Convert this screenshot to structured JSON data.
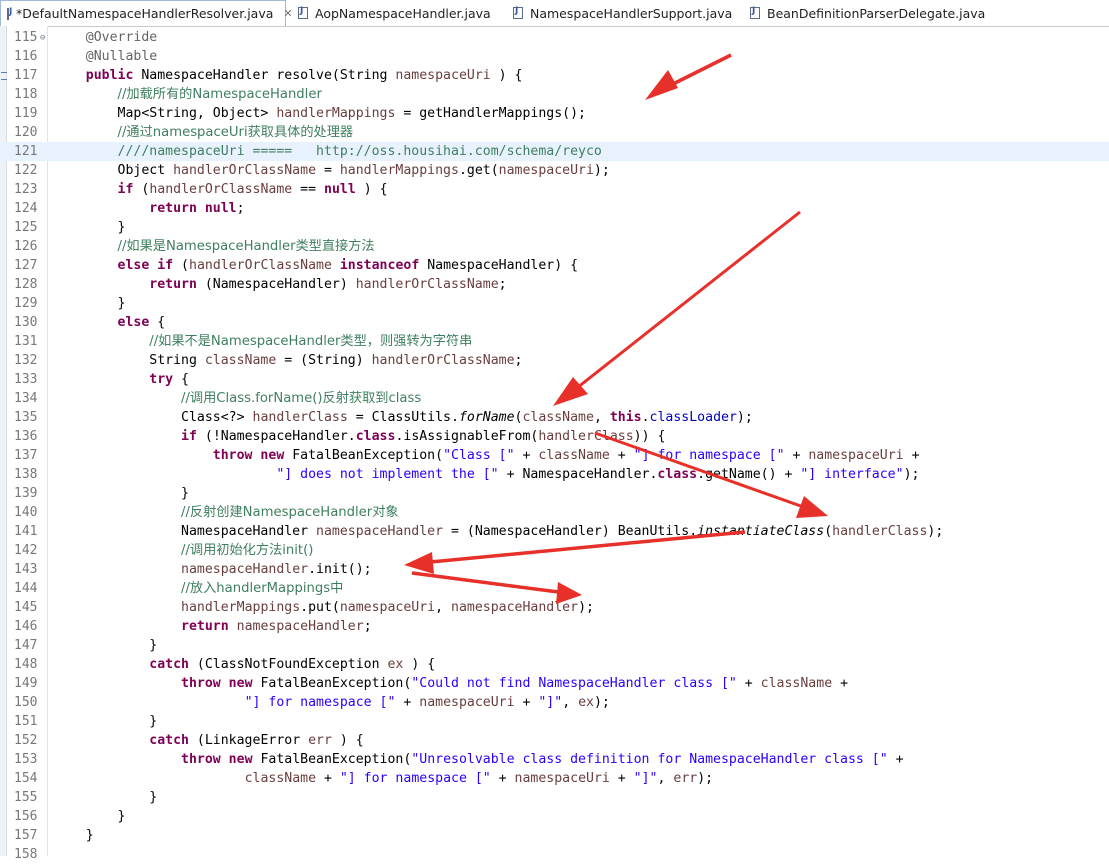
{
  "tabs": [
    {
      "label": "*DefaultNamespaceHandlerResolver.java",
      "active": true,
      "closable": true
    },
    {
      "label": "AopNamespaceHandler.java",
      "active": false
    },
    {
      "label": "NamespaceHandlerSupport.java",
      "active": false
    },
    {
      "label": "BeanDefinitionParserDelegate.java",
      "active": false
    }
  ],
  "editor": {
    "current_line": 121,
    "lines": [
      {
        "n": "115",
        "fold": true,
        "tokens": [
          [
            "ann",
            "    @Override"
          ]
        ]
      },
      {
        "n": "116",
        "tokens": [
          [
            "ann",
            "    @Nullable"
          ]
        ]
      },
      {
        "n": "117",
        "marker": true,
        "tokens": [
          [
            "",
            "    "
          ],
          [
            "kw",
            "public"
          ],
          [
            "",
            " NamespaceHandler resolve(String "
          ],
          [
            "lv",
            "namespaceUri"
          ],
          [
            "",
            " ) {"
          ]
        ]
      },
      {
        "n": "118",
        "tokens": [
          [
            "",
            "        "
          ],
          [
            "cmt",
            "//加载所有的NamespaceHandler"
          ]
        ]
      },
      {
        "n": "119",
        "tokens": [
          [
            "",
            "        Map<String, Object> "
          ],
          [
            "lv",
            "handlerMappings"
          ],
          [
            "",
            " = getHandlerMappings();"
          ]
        ]
      },
      {
        "n": "120",
        "tokens": [
          [
            "",
            "        "
          ],
          [
            "cmt",
            "//通过namespaceUri获取具体的处理器"
          ]
        ]
      },
      {
        "n": "121",
        "tokens": [
          [
            "",
            "        "
          ],
          [
            "cmt",
            "////namespaceUri =====   http://oss.housihai.com/schema/reyco"
          ]
        ]
      },
      {
        "n": "122",
        "tokens": [
          [
            "",
            "        Object "
          ],
          [
            "lv",
            "handlerOrClassName"
          ],
          [
            "",
            " = "
          ],
          [
            "lv",
            "handlerMappings"
          ],
          [
            "",
            ".get("
          ],
          [
            "lv",
            "namespaceUri"
          ],
          [
            "",
            ");"
          ]
        ]
      },
      {
        "n": "123",
        "tokens": [
          [
            "",
            "        "
          ],
          [
            "kw",
            "if"
          ],
          [
            "",
            " ("
          ],
          [
            "lv",
            "handlerOrClassName"
          ],
          [
            "",
            " == "
          ],
          [
            "kw",
            "null"
          ],
          [
            "",
            " ) {"
          ]
        ]
      },
      {
        "n": "124",
        "tokens": [
          [
            "",
            "            "
          ],
          [
            "kw",
            "return"
          ],
          [
            "",
            ""
          ],
          [
            "kw",
            " null"
          ],
          [
            "",
            ";"
          ]
        ]
      },
      {
        "n": "125",
        "tokens": [
          [
            "",
            "        }"
          ]
        ]
      },
      {
        "n": "126",
        "tokens": [
          [
            "",
            "        "
          ],
          [
            "cmt",
            "//如果是NamespaceHandler类型直接方法"
          ]
        ]
      },
      {
        "n": "127",
        "tokens": [
          [
            "",
            "        "
          ],
          [
            "kw",
            "else if"
          ],
          [
            "",
            " ("
          ],
          [
            "lv",
            "handlerOrClassName"
          ],
          [
            "",
            ""
          ],
          [
            "kw",
            " instanceof"
          ],
          [
            "",
            " NamespaceHandler) {"
          ]
        ]
      },
      {
        "n": "128",
        "tokens": [
          [
            "",
            "            "
          ],
          [
            "kw",
            "return"
          ],
          [
            "",
            " (NamespaceHandler) "
          ],
          [
            "lv",
            "handlerOrClassName"
          ],
          [
            "",
            ";"
          ]
        ]
      },
      {
        "n": "129",
        "tokens": [
          [
            "",
            "        }"
          ]
        ]
      },
      {
        "n": "130",
        "tokens": [
          [
            "",
            "        "
          ],
          [
            "kw",
            "else"
          ],
          [
            "",
            " {"
          ]
        ]
      },
      {
        "n": "131",
        "tokens": [
          [
            "",
            "            "
          ],
          [
            "cmt",
            "//如果不是NamespaceHandler类型，则强转为字符串"
          ]
        ]
      },
      {
        "n": "132",
        "tokens": [
          [
            "",
            "            String "
          ],
          [
            "lv",
            "className"
          ],
          [
            "",
            " = (String) "
          ],
          [
            "lv",
            "handlerOrClassName"
          ],
          [
            "",
            ";"
          ]
        ]
      },
      {
        "n": "133",
        "tokens": [
          [
            "",
            "            "
          ],
          [
            "kw",
            "try"
          ],
          [
            "",
            " {"
          ]
        ]
      },
      {
        "n": "134",
        "tokens": [
          [
            "",
            "                "
          ],
          [
            "cmt",
            "//调用Class.forName()反射获取到class"
          ]
        ]
      },
      {
        "n": "135",
        "tokens": [
          [
            "",
            "                Class<?> "
          ],
          [
            "lv",
            "handlerClass"
          ],
          [
            "",
            " = ClassUtils."
          ],
          [
            "it",
            "forName"
          ],
          [
            "",
            "("
          ],
          [
            "lv",
            "className"
          ],
          [
            "",
            ", "
          ],
          [
            "kw",
            "this"
          ],
          [
            "",
            "."
          ],
          [
            "fld",
            "classLoader"
          ],
          [
            "",
            ");"
          ]
        ]
      },
      {
        "n": "136",
        "tokens": [
          [
            "",
            "                "
          ],
          [
            "kw",
            "if"
          ],
          [
            "",
            " (!NamespaceHandler."
          ],
          [
            "kw",
            "class"
          ],
          [
            "",
            ".isAssignableFrom("
          ],
          [
            "lv",
            "handlerClass"
          ],
          [
            "",
            ")) {"
          ]
        ]
      },
      {
        "n": "137",
        "tokens": [
          [
            "",
            "                    "
          ],
          [
            "kw",
            "throw new"
          ],
          [
            "",
            " FatalBeanException("
          ],
          [
            "str",
            "\"Class [\""
          ],
          [
            "",
            " + "
          ],
          [
            "lv",
            "className"
          ],
          [
            "",
            " + "
          ],
          [
            "str",
            "\"] for namespace [\""
          ],
          [
            "",
            " + "
          ],
          [
            "lv",
            "namespaceUri"
          ],
          [
            "",
            " +"
          ]
        ]
      },
      {
        "n": "138",
        "tokens": [
          [
            "",
            "                            "
          ],
          [
            "str",
            "\"] does not implement the [\""
          ],
          [
            "",
            " + NamespaceHandler."
          ],
          [
            "kw",
            "class"
          ],
          [
            "",
            ".getName() + "
          ],
          [
            "str",
            "\"] interface\""
          ],
          [
            "",
            ");"
          ]
        ]
      },
      {
        "n": "139",
        "tokens": [
          [
            "",
            "                }"
          ]
        ]
      },
      {
        "n": "140",
        "tokens": [
          [
            "",
            "                "
          ],
          [
            "cmt",
            "//反射创建NamespaceHandler对象"
          ]
        ]
      },
      {
        "n": "141",
        "tokens": [
          [
            "",
            "                NamespaceHandler "
          ],
          [
            "lv",
            "namespaceHandler"
          ],
          [
            "",
            " = (NamespaceHandler) BeanUtils."
          ],
          [
            "it",
            "instantiateClass"
          ],
          [
            "",
            "("
          ],
          [
            "lv",
            "handlerClass"
          ],
          [
            "",
            ");"
          ]
        ]
      },
      {
        "n": "142",
        "tokens": [
          [
            "",
            "                "
          ],
          [
            "cmt",
            "//调用初始化方法init()"
          ]
        ]
      },
      {
        "n": "143",
        "tokens": [
          [
            "",
            "                "
          ],
          [
            "lv",
            "namespaceHandler"
          ],
          [
            "",
            ".init();"
          ]
        ]
      },
      {
        "n": "144",
        "tokens": [
          [
            "",
            "                "
          ],
          [
            "cmt",
            "//放入handlerMappings中"
          ]
        ]
      },
      {
        "n": "145",
        "tokens": [
          [
            "",
            "                "
          ],
          [
            "lv",
            "handlerMappings"
          ],
          [
            "",
            ".put("
          ],
          [
            "lv",
            "namespaceUri"
          ],
          [
            "",
            ", "
          ],
          [
            "lv",
            "namespaceHandler"
          ],
          [
            "",
            ");"
          ]
        ]
      },
      {
        "n": "146",
        "tokens": [
          [
            "",
            "                "
          ],
          [
            "kw",
            "return"
          ],
          [
            "",
            " "
          ],
          [
            "lv",
            "namespaceHandler"
          ],
          [
            "",
            ";"
          ]
        ]
      },
      {
        "n": "147",
        "tokens": [
          [
            "",
            "            }"
          ]
        ]
      },
      {
        "n": "148",
        "tokens": [
          [
            "",
            "            "
          ],
          [
            "kw",
            "catch"
          ],
          [
            "",
            " (ClassNotFoundException "
          ],
          [
            "lv",
            "ex"
          ],
          [
            "",
            " ) {"
          ]
        ]
      },
      {
        "n": "149",
        "tokens": [
          [
            "",
            "                "
          ],
          [
            "kw",
            "throw new"
          ],
          [
            "",
            " FatalBeanException("
          ],
          [
            "str",
            "\"Could not find NamespaceHandler class [\""
          ],
          [
            "",
            " + "
          ],
          [
            "lv",
            "className"
          ],
          [
            "",
            " +"
          ]
        ]
      },
      {
        "n": "150",
        "tokens": [
          [
            "",
            "                        "
          ],
          [
            "str",
            "\"] for namespace [\""
          ],
          [
            "",
            " + "
          ],
          [
            "lv",
            "namespaceUri"
          ],
          [
            "",
            " + "
          ],
          [
            "str",
            "\"]\""
          ],
          [
            "",
            ", "
          ],
          [
            "lv",
            "ex"
          ],
          [
            "",
            ");"
          ]
        ]
      },
      {
        "n": "151",
        "tokens": [
          [
            "",
            "            }"
          ]
        ]
      },
      {
        "n": "152",
        "tokens": [
          [
            "",
            "            "
          ],
          [
            "kw",
            "catch"
          ],
          [
            "",
            " (LinkageError "
          ],
          [
            "lv",
            "err"
          ],
          [
            "",
            " ) {"
          ]
        ]
      },
      {
        "n": "153",
        "tokens": [
          [
            "",
            "                "
          ],
          [
            "kw",
            "throw new"
          ],
          [
            "",
            " FatalBeanException("
          ],
          [
            "str",
            "\"Unresolvable class definition for NamespaceHandler class [\""
          ],
          [
            "",
            " +"
          ]
        ]
      },
      {
        "n": "154",
        "tokens": [
          [
            "",
            "                        "
          ],
          [
            "lv",
            "className"
          ],
          [
            "",
            " + "
          ],
          [
            "str",
            "\"] for namespace [\""
          ],
          [
            "",
            " + "
          ],
          [
            "lv",
            "namespaceUri"
          ],
          [
            "",
            " + "
          ],
          [
            "str",
            "\"]\""
          ],
          [
            "",
            ", "
          ],
          [
            "lv",
            "err"
          ],
          [
            "",
            ");"
          ]
        ]
      },
      {
        "n": "155",
        "tokens": [
          [
            "",
            "            }"
          ]
        ]
      },
      {
        "n": "156",
        "tokens": [
          [
            "",
            "        }"
          ]
        ]
      },
      {
        "n": "157",
        "tokens": [
          [
            "",
            "    }"
          ]
        ]
      },
      {
        "n": "158",
        "tokens": []
      }
    ]
  },
  "colors": {
    "keyword": "#7f0055",
    "comment": "#3f7f5f",
    "string": "#2a00ff",
    "annotation": "#646464",
    "field": "#0000c0",
    "local_variable": "#6a3e3e",
    "current_line": "#e8f2fe",
    "arrow": "#e8302a"
  }
}
